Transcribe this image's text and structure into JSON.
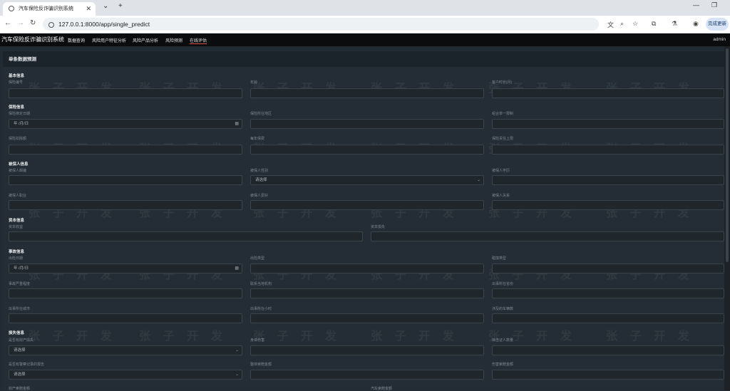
{
  "browser": {
    "tab_title": "汽车保险反诈骗识别系统",
    "url": "127.0.0.1:8000/app/single_predict",
    "update_button": "完成更新"
  },
  "app": {
    "brand": "汽车保险反诈骗识别系统",
    "nav": [
      "数据查询",
      "风险用户特征分析",
      "风险产品分析",
      "风险预测",
      "在线评估"
    ],
    "user": "admin"
  },
  "card": {
    "title": "单条数据预测"
  },
  "sections": {
    "basic": "基本信息",
    "policy": "保险信息",
    "insured": "被保人信息",
    "capital": "资本信息",
    "accident": "事故信息",
    "loss": "损失信息"
  },
  "fields": {
    "policy_no": "保险编号",
    "age": "年龄",
    "customer_months": "客户时长(月)",
    "bind_date": "保险绑定日期",
    "policy_state": "保险所在地区",
    "combined_limit": "组合单一限制",
    "deductible": "保险扣除额",
    "annual_premium": "每年保费",
    "umbrella_limit": "保险责任上限",
    "zip": "被保人邮编",
    "sex": "被保人性别",
    "education": "被保人学历",
    "occupation": "被保人职业",
    "hobby": "被保人爱好",
    "relationship": "被保人关系",
    "capital_gain": "资本收益",
    "capital_loss": "资本损失",
    "incident_date": "出险日期",
    "incident_type": "出险类型",
    "collision_type": "碰撞类型",
    "severity": "事故严重程度",
    "authority": "联系当地机构",
    "incident_state": "出事所在省份",
    "incident_city": "出事所在城市",
    "incident_hour": "出事所在小时",
    "vehicles": "涉及的车辆数",
    "property_damage": "是否有财产损失",
    "bodily_injuries": "身体伤害",
    "witnesses": "目击证人数量",
    "police_report": "是否有警察记录的报告",
    "total_claim": "整体索赔金额",
    "injury_claim": "伤害索赔金额",
    "property_claim": "财产索赔金额",
    "vehicle_claim": "汽车索赔金额"
  },
  "placeholders": {
    "date": "年 /月/日",
    "select": "请选择"
  },
  "watermark": "张 子 开 发"
}
